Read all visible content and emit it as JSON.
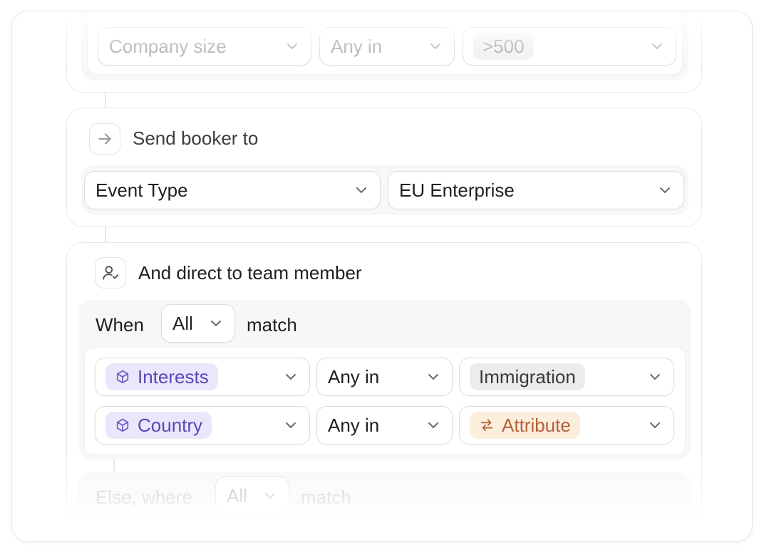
{
  "top_rule": {
    "field": "Company size",
    "operator": "Any in",
    "value": ">500"
  },
  "send_booker": {
    "title": "Send booker to",
    "type_select": "Event Type",
    "target_select": "EU Enterprise",
    "icon": "arrow-right-icon"
  },
  "direct_member": {
    "title": "And direct to team member",
    "icon": "user-check-icon",
    "when_label": "When",
    "match_mode": "All",
    "match_label": "match",
    "rules": [
      {
        "field": "Interests",
        "operator": "Any in",
        "value": "Immigration",
        "field_icon": "cube-icon"
      },
      {
        "field": "Country",
        "operator": "Any in",
        "value": "Attribute",
        "field_icon": "cube-icon",
        "value_icon": "swap-arrows-icon"
      }
    ],
    "else_label": "Else, where",
    "else_match_mode": "All",
    "else_match_label": "match"
  },
  "colors": {
    "field_chip_bg": "#ebe6fb",
    "field_chip_text": "#5a47b8",
    "attribute_chip_bg": "#fbeedd",
    "attribute_chip_text": "#b5623a"
  }
}
